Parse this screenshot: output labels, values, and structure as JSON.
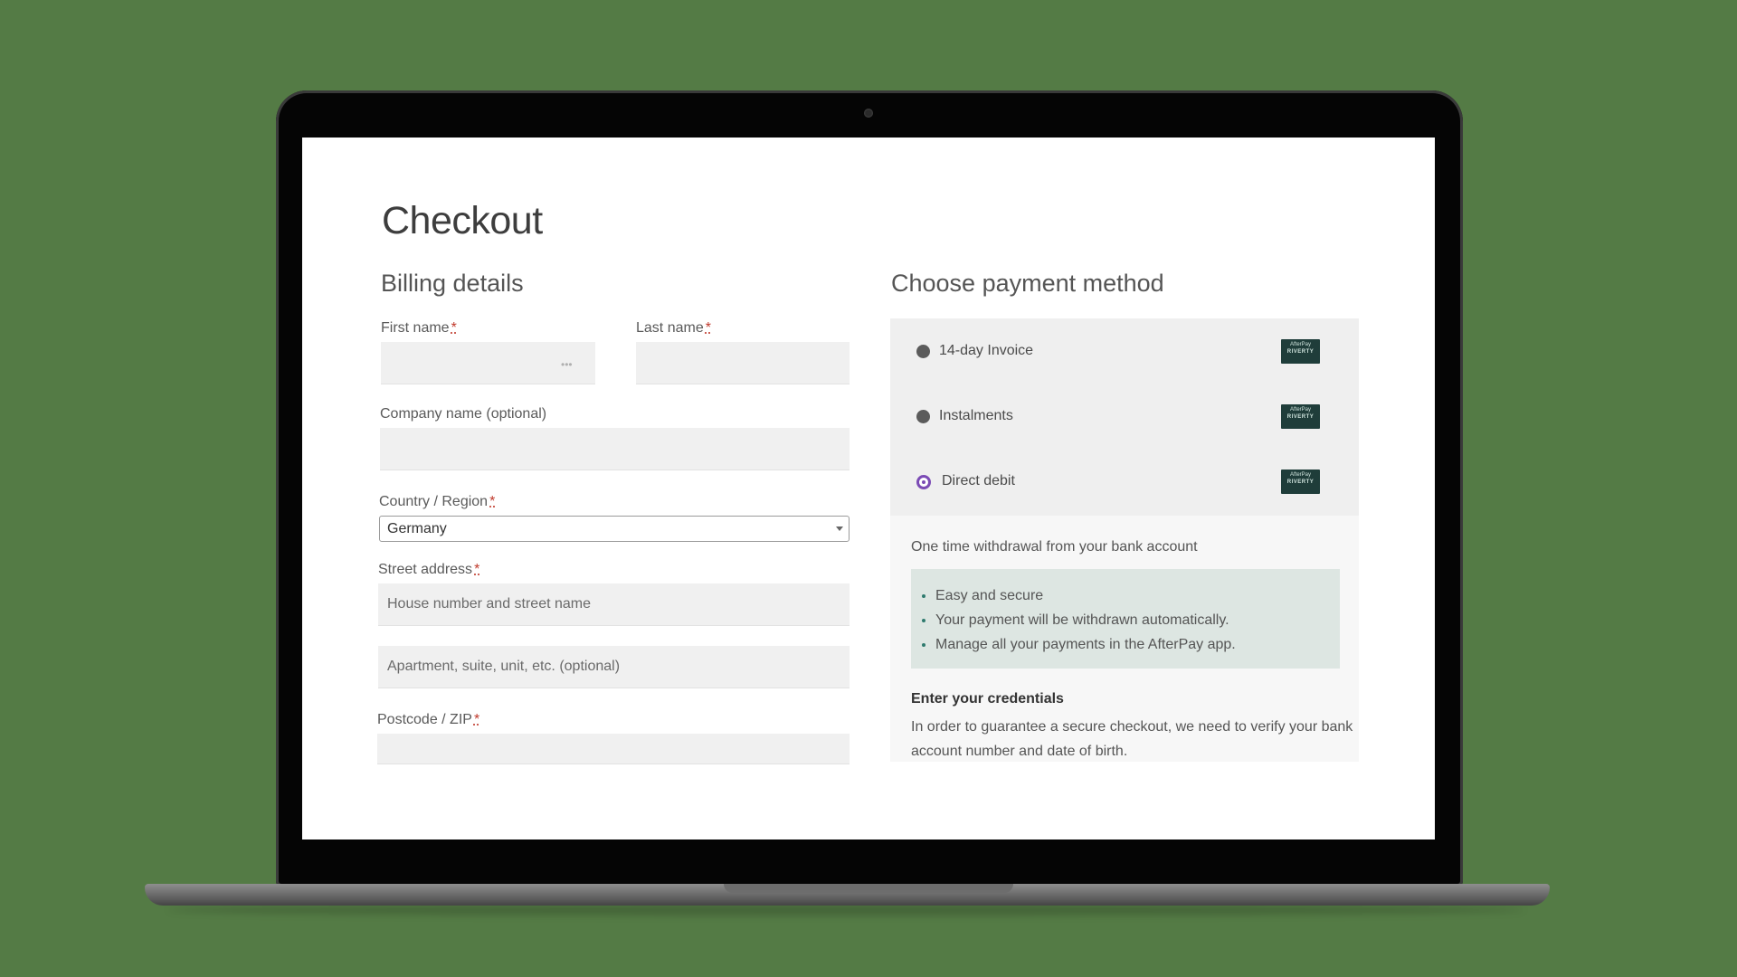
{
  "page": {
    "title": "Checkout"
  },
  "billing": {
    "title": "Billing details",
    "first_name": {
      "label": "First name",
      "required_mark": "*",
      "value": ""
    },
    "last_name": {
      "label": "Last name",
      "required_mark": "*",
      "value": ""
    },
    "company": {
      "label": "Company name (optional)",
      "value": ""
    },
    "country": {
      "label": "Country / Region",
      "required_mark": "*",
      "value": "Germany"
    },
    "street": {
      "label": "Street address",
      "required_mark": "*",
      "placeholder": "House number and street name",
      "placeholder2": "Apartment, suite, unit, etc. (optional)"
    },
    "postcode": {
      "label": "Postcode / ZIP",
      "required_mark": "*",
      "value": ""
    },
    "autofill_icon": "dots-icon"
  },
  "payment": {
    "title": "Choose payment method",
    "options": [
      {
        "label": "14-day Invoice",
        "selected": false,
        "logo": "AfterPay RIVERTY"
      },
      {
        "label": "Instalments",
        "selected": false,
        "logo": "AfterPay RIVERTY"
      },
      {
        "label": "Direct debit",
        "selected": true,
        "logo": "AfterPay RIVERTY"
      }
    ],
    "description": "One time withdrawal from your bank account",
    "benefits": [
      "Easy and secure",
      "Your payment will be withdrawn automatically.",
      "Manage all your payments in the AfterPay app."
    ],
    "credentials_title": "Enter your credentials",
    "credentials_text": "In order to guarantee a secure checkout, we need to verify your bank account number and date of birth."
  },
  "colors": {
    "background": "#547b45",
    "accent_radio": "#7b4bb5",
    "benefits_bg": "#dde6e2",
    "logo_bg": "#1f3d3a"
  }
}
